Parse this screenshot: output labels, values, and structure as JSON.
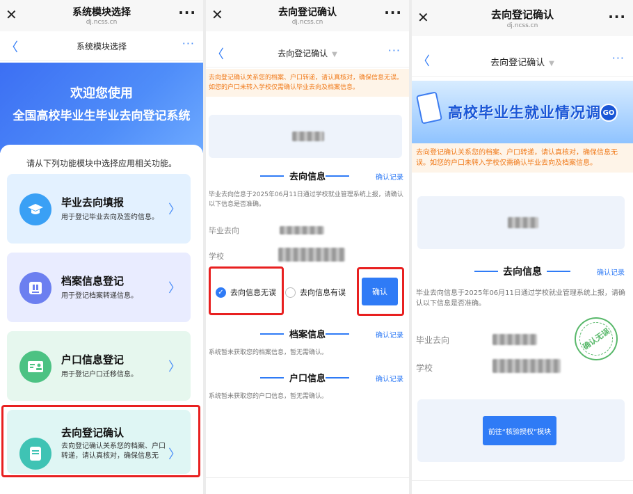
{
  "panel1": {
    "wx_title": "系统模块选择",
    "wx_url": "dj.ncss.cn",
    "nav_title": "系统模块选择",
    "hero_line1": "欢迎您使用",
    "hero_line2": "全国高校毕业生毕业去向登记系统",
    "intro": "请从下列功能模块中选择应用相关功能。",
    "modules": [
      {
        "title": "毕业去向填报",
        "desc": "用于登记毕业去向及签约信息。",
        "bg": "#e3f1ff",
        "icon_bg": "#3aa0f5"
      },
      {
        "title": "档案信息登记",
        "desc": "用于登记档案转递信息。",
        "bg": "#e9ecff",
        "icon_bg": "#6c7ff0"
      },
      {
        "title": "户口信息登记",
        "desc": "用于登记户口迁移信息。",
        "bg": "#e6f7ee",
        "icon_bg": "#4cc283"
      },
      {
        "title": "去向登记确认",
        "desc": "去向登记确认关系您的档案、户口转递，请认真核对，确保信息无",
        "bg": "#dff6f4",
        "icon_bg": "#3fc3b4"
      }
    ]
  },
  "panel2": {
    "wx_title": "去向登记确认",
    "wx_url": "dj.ncss.cn",
    "nav_title": "去向登记确认",
    "notice": "去向登记确认关系您的档案、户口转递，请认真核对，确保信息无误。如您的户口未转入学校仅需确认毕业去向及档案信息。",
    "dest_section": "去向信息",
    "confirm_record": "确认记录",
    "dest_desc": "毕业去向信息于2025年06月11日通过学校就业管理系统上报，请确认以下信息是否准确。",
    "label_dest": "毕业去向",
    "label_school": "学校",
    "option_ok": "去向信息无误",
    "option_err": "去向信息有误",
    "confirm_btn": "确认",
    "archive_section": "档案信息",
    "archive_desc": "系统暂未获取您的档案信息，暂无需确认。",
    "hukou_section": "户口信息",
    "hukou_desc": "系统暂未获取您的户口信息，暂无需确认。"
  },
  "panel3": {
    "wx_title": "去向登记确认",
    "wx_url": "dj.ncss.cn",
    "nav_title": "去向登记确认",
    "banner": "高校毕业生就业情况调查",
    "banner_go": "GO",
    "notice": "去向登记确认关系您的档案、户口转递，请认真核对，确保信息无误。如您的户口未转入学校仅需确认毕业去向及档案信息。",
    "dest_section": "去向信息",
    "confirm_record": "确认记录",
    "dest_desc": "毕业去向信息于2025年06月11日通过学校就业管理系统上报，请确认以下信息是否准确。",
    "label_dest": "毕业去向",
    "label_school": "学校",
    "stamp": "确认无误",
    "goto_btn": "前往“核验授权”模块"
  }
}
